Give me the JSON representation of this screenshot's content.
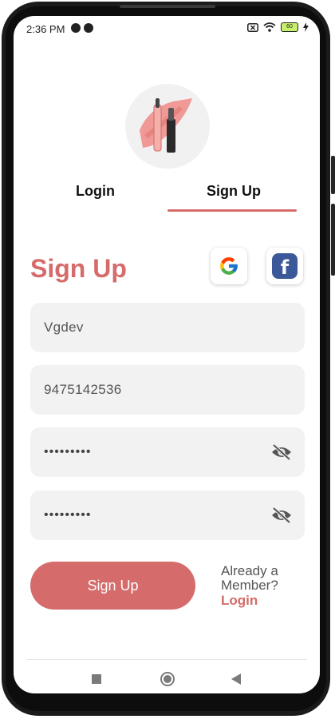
{
  "status_bar": {
    "time": "2:36 PM",
    "battery": "60",
    "icons": [
      "media-icon",
      "media-icon",
      "notification-x-icon",
      "wifi-icon",
      "battery-icon",
      "charging-icon"
    ]
  },
  "app": {
    "logo_icon": "lipstick-logo-icon",
    "tabs": [
      {
        "label": "Login",
        "active": false
      },
      {
        "label": "Sign Up",
        "active": true
      }
    ],
    "title": "Sign Up",
    "social": {
      "google_icon": "google-icon",
      "facebook_icon": "facebook-icon",
      "facebook_letter": "f"
    },
    "fields": {
      "name": "Vgdev",
      "phone": "9475142536",
      "password": "•••••••••",
      "confirm_password": "•••••••••"
    },
    "submit_label": "Sign Up",
    "already_text": "Already a Member?",
    "login_link": "Login"
  },
  "colors": {
    "accent": "#d56b6a",
    "field_bg": "#f2f2f2",
    "facebook": "#3b5998"
  },
  "nav_bar": {
    "icons": [
      "recent-apps-icon",
      "home-icon",
      "back-icon"
    ]
  }
}
